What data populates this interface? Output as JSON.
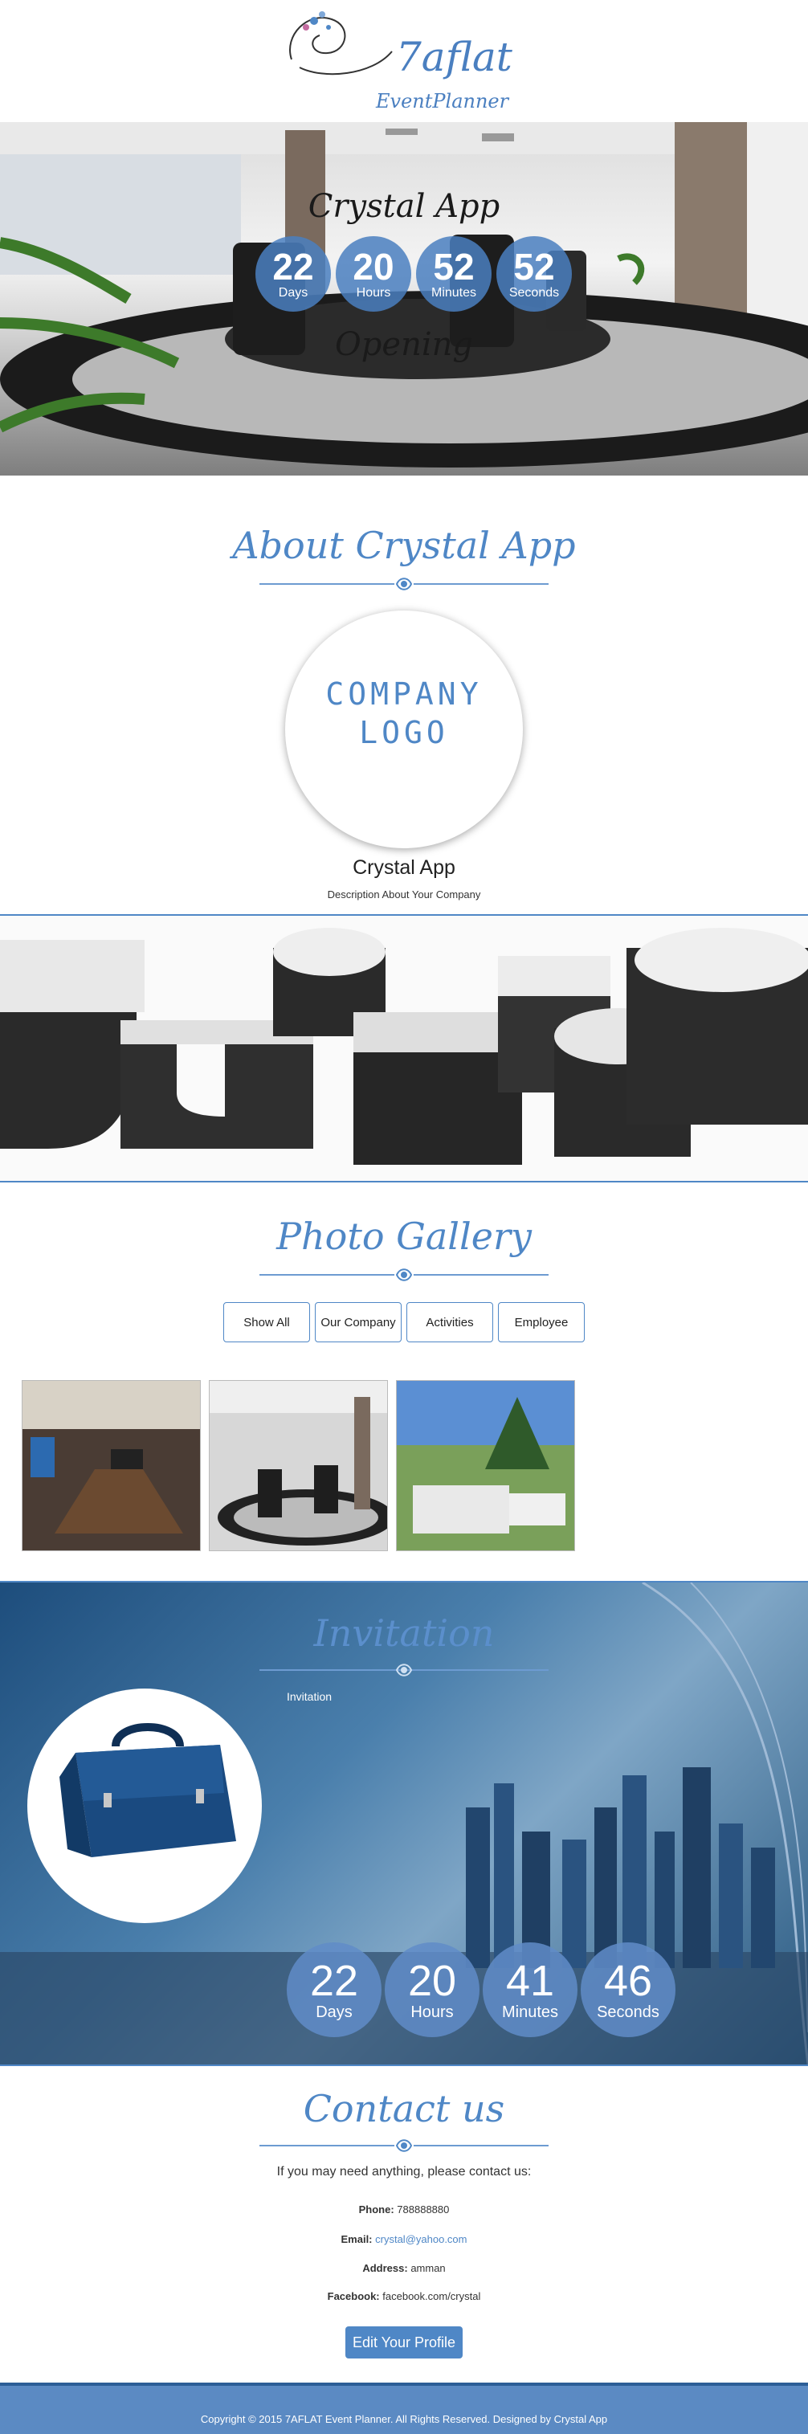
{
  "header": {
    "logo_main": "7aflat",
    "logo_sub": "EventPlanner"
  },
  "hero": {
    "title": "Crystal App",
    "subtitle": "Opening",
    "countdown": [
      {
        "value": "22",
        "label": "Days"
      },
      {
        "value": "20",
        "label": "Hours"
      },
      {
        "value": "52",
        "label": "Minutes"
      },
      {
        "value": "52",
        "label": "Seconds"
      }
    ]
  },
  "about": {
    "title": "About Crystal App",
    "logo_line1": "COMPANY",
    "logo_line2": "LOGO",
    "name": "Crystal App",
    "description": "Description About Your Company"
  },
  "gallery": {
    "title": "Photo Gallery",
    "filters": [
      "Show All",
      "Our Company",
      "Activities",
      "Employee"
    ]
  },
  "invitation": {
    "title": "Invitation",
    "text": "Invitation",
    "countdown": [
      {
        "value": "22",
        "label": "Days"
      },
      {
        "value": "20",
        "label": "Hours"
      },
      {
        "value": "41",
        "label": "Minutes"
      },
      {
        "value": "46",
        "label": "Seconds"
      }
    ]
  },
  "contact": {
    "title": "Contact us",
    "intro": "If you may need anything, please contact us:",
    "phone_label": "Phone:",
    "phone": "788888880",
    "email_label": "Email:",
    "email": "crystal@yahoo.com",
    "address_label": "Address:",
    "address": "amman",
    "facebook_label": "Facebook:",
    "facebook": "facebook.com/crystal",
    "edit_button": "Edit Your Profile"
  },
  "footer": {
    "copyright": "Copyright © 2015 7AFLAT Event Planner. All Rights Reserved. Designed by Crystal App"
  },
  "colors": {
    "accent": "#4f87c6",
    "footer": "#5b8ac3"
  }
}
